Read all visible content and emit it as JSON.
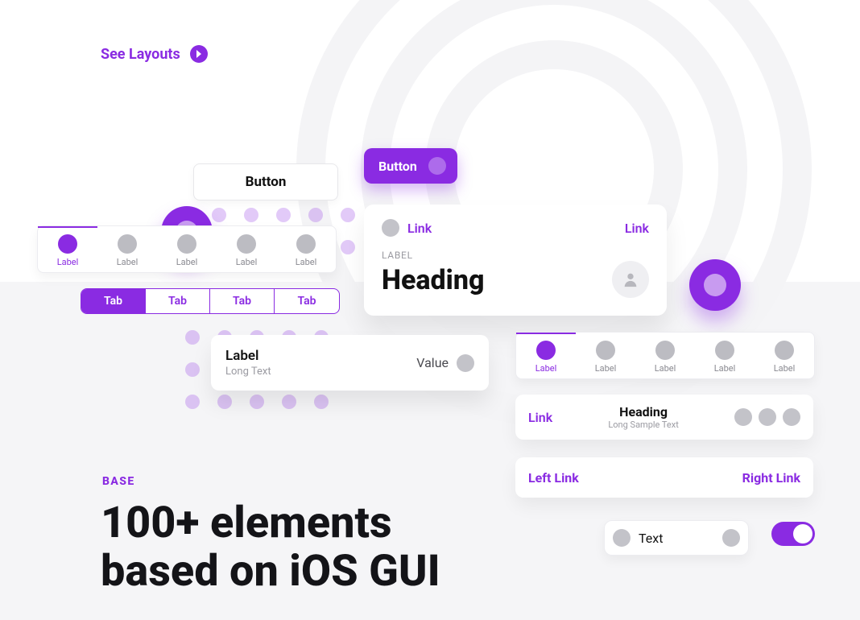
{
  "colors": {
    "accent": "#8a2be2"
  },
  "top_link": {
    "label": "See Layouts"
  },
  "plain_button": {
    "label": "Button"
  },
  "purple_button": {
    "label": "Button"
  },
  "icon_tabs_left": {
    "items": [
      {
        "label": "Label",
        "active": true
      },
      {
        "label": "Label",
        "active": false
      },
      {
        "label": "Label",
        "active": false
      },
      {
        "label": "Label",
        "active": false
      },
      {
        "label": "Label",
        "active": false
      }
    ]
  },
  "icon_tabs_right": {
    "items": [
      {
        "label": "Label",
        "active": true
      },
      {
        "label": "Label",
        "active": false
      },
      {
        "label": "Label",
        "active": false
      },
      {
        "label": "Label",
        "active": false
      },
      {
        "label": "Label",
        "active": false
      }
    ]
  },
  "segmented": {
    "items": [
      {
        "label": "Tab",
        "active": true
      },
      {
        "label": "Tab",
        "active": false
      },
      {
        "label": "Tab",
        "active": false
      },
      {
        "label": "Tab",
        "active": false
      }
    ]
  },
  "heading_card": {
    "link_left": "Link",
    "link_right": "Link",
    "tiny_label": "LABEL",
    "heading": "Heading"
  },
  "lv_card": {
    "title": "Label",
    "subtitle": "Long Text",
    "value": "Value"
  },
  "link_heading_card": {
    "link": "Link",
    "heading": "Heading",
    "subtitle": "Long Sample Text"
  },
  "lr_bar": {
    "left": "Left Link",
    "right": "Right Link"
  },
  "chip": {
    "text": "Text"
  },
  "toggle": {
    "on": true
  },
  "section": {
    "label": "BASE",
    "title_line1": "100+ elements",
    "title_line2": "based on iOS GUI"
  }
}
